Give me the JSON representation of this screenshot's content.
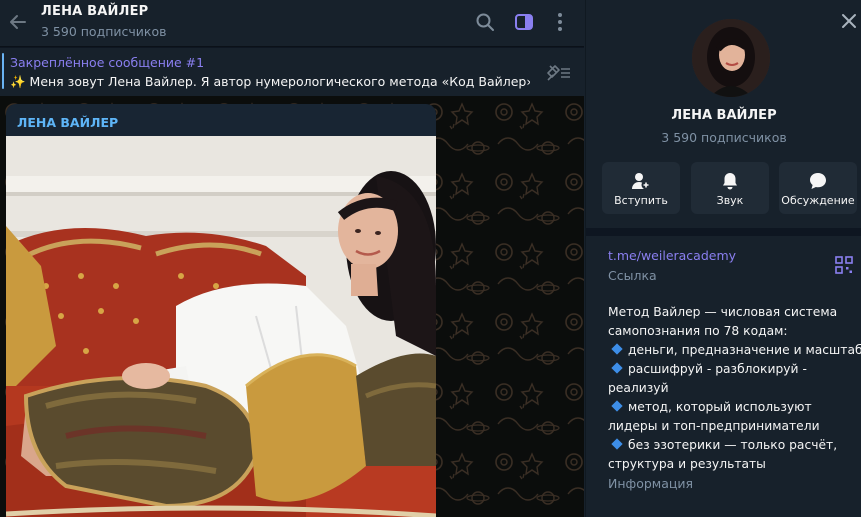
{
  "header": {
    "title": "ЛЕНА ВАЙЛЕР",
    "subscribers": "3 590 подписчиков"
  },
  "pinned": {
    "title": "Закреплённое сообщение #1",
    "text": "✨ Меня зовут Лена Вайлер.  Я автор нумерологического метода  «Код Вайлер» ..."
  },
  "message": {
    "author": "ЛЕНА ВАЙЛЕР"
  },
  "panel": {
    "name": "ЛЕНА ВАЙЛЕР",
    "subscribers": "3 590 подписчиков",
    "actions": {
      "join": "Вступить",
      "sound": "Звук",
      "discussion": "Обсуждение"
    },
    "link": "t.me/weileracademy",
    "link_label": "Ссылка",
    "description": {
      "intro1": "Метод  Вайлер — числовая система",
      "intro2": "самопознания по 78 кодам:",
      "b1": "деньги, предназначение и масштаб",
      "b2a": "расшифруй - разблокируй -",
      "b2b": "реализуй",
      "b3a": "метод, который используют",
      "b3b": "лидеры и топ-предприниматели",
      "b4a": "без эзотерики — только расчёт,",
      "b4b": "структура и результаты"
    },
    "info_label": "Информация"
  },
  "colors": {
    "accent": "#8a7ff0",
    "author": "#5eb5f7",
    "bullet": "#3d8ee8",
    "panel_bg": "#17212b"
  }
}
